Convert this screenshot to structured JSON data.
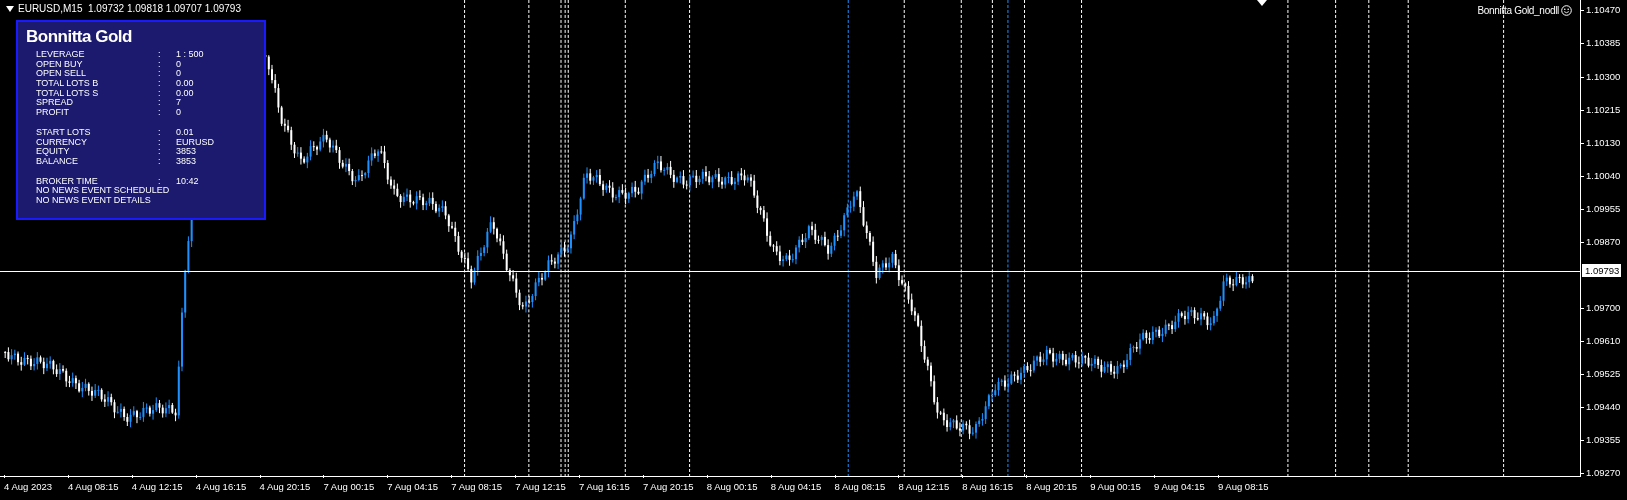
{
  "chart_header": {
    "text": "EURUSD,M15  1.09732 1.09818 1.09707 1.09793"
  },
  "indicator_label": "Bonnitta Gold_nodll",
  "info_panel": {
    "title": "Bonnitta Gold",
    "groups": [
      [
        {
          "kind": "pair",
          "label": "LEVERAGE",
          "value": "1 : 500"
        },
        {
          "kind": "pair",
          "label": "OPEN BUY",
          "value": "0"
        },
        {
          "kind": "pair",
          "label": "OPEN SELL",
          "value": "0"
        },
        {
          "kind": "pair",
          "label": "TOTAL LOTS B",
          "value": "0.00"
        },
        {
          "kind": "pair",
          "label": "TOTAL LOTS S",
          "value": "0.00"
        },
        {
          "kind": "pair",
          "label": "SPREAD",
          "value": "7"
        },
        {
          "kind": "pair",
          "label": "PROFIT",
          "value": "0"
        }
      ],
      [
        {
          "kind": "pair",
          "label": "START LOTS",
          "value": "0.01"
        },
        {
          "kind": "pair",
          "label": "CURRENCY",
          "value": "EURUSD"
        },
        {
          "kind": "pair",
          "label": "EQUITY",
          "value": "3853"
        },
        {
          "kind": "pair",
          "label": "BALANCE",
          "value": "3853"
        }
      ],
      [
        {
          "kind": "pair",
          "label": "BROKER TIME",
          "value": "10:42"
        },
        {
          "kind": "note",
          "label": "NO NEWS EVENT SCHEDULED"
        },
        {
          "kind": "note",
          "label": "NO NEWS EVENT DETAILS"
        }
      ]
    ],
    "separator": ":"
  },
  "price_axis": {
    "ticks": [
      "1.10470",
      "1.10385",
      "1.10300",
      "1.10215",
      "1.10130",
      "1.10040",
      "1.09955",
      "1.09870",
      "1.09700",
      "1.09610",
      "1.09525",
      "1.09440",
      "1.09355",
      "1.09270"
    ],
    "current": "1.09793"
  },
  "time_axis": {
    "labels": [
      "4 Aug 2023",
      "4 Aug 08:15",
      "4 Aug 12:15",
      "4 Aug 16:15",
      "4 Aug 20:15",
      "7 Aug 00:15",
      "7 Aug 04:15",
      "7 Aug 08:15",
      "7 Aug 12:15",
      "7 Aug 16:15",
      "7 Aug 20:15",
      "8 Aug 00:15",
      "8 Aug 04:15",
      "8 Aug 08:15",
      "8 Aug 12:15",
      "8 Aug 16:15",
      "8 Aug 20:15",
      "9 Aug 00:15",
      "9 Aug 04:15",
      "9 Aug 08:15"
    ]
  }
}
